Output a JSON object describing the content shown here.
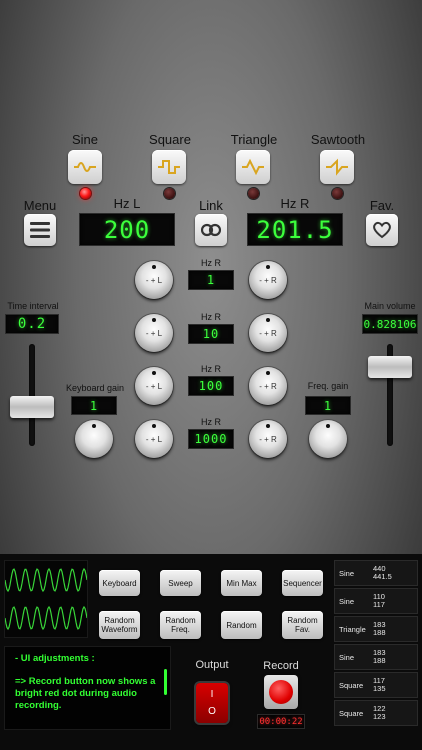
{
  "waveforms": [
    {
      "label": "Sine",
      "active": true
    },
    {
      "label": "Square",
      "active": false
    },
    {
      "label": "Triangle",
      "active": false
    },
    {
      "label": "Sawtooth",
      "active": false
    }
  ],
  "menu_label": "Menu",
  "link_label": "Link",
  "fav_label": "Fav.",
  "hz_l": {
    "label": "Hz L",
    "value": "200"
  },
  "hz_r": {
    "label": "Hz R",
    "value": "201.5"
  },
  "knob_minus_l": "- + L",
  "knob_minus_r": "- + R",
  "steps": [
    {
      "label": "Hz R",
      "value": "1"
    },
    {
      "label": "Hz R",
      "value": "10"
    },
    {
      "label": "Hz R",
      "value": "100"
    },
    {
      "label": "Hz R",
      "value": "1000"
    }
  ],
  "time_interval": {
    "label": "Time interval",
    "value": "0.2"
  },
  "main_volume": {
    "label": "Main volume",
    "value": "0.828106"
  },
  "keyboard_gain": {
    "label": "Keyboard gain",
    "value": "1"
  },
  "freq_gain": {
    "label": "Freq. gain",
    "value": "1"
  },
  "pads": [
    {
      "label": "Keyboard"
    },
    {
      "label": "Sweep"
    },
    {
      "label": "Min Max"
    },
    {
      "label": "Sequencer"
    },
    {
      "label": "Random Waveform"
    },
    {
      "label": "Random Freq."
    },
    {
      "label": "Random"
    },
    {
      "label": "Random Fav."
    }
  ],
  "log": {
    "title": "- UI adjustments :",
    "body": "=> Record button now shows a bright red dot during audio recording."
  },
  "output_label": "Output",
  "record_label": "Record",
  "record_time": "00:00:22",
  "power_on": "I",
  "power_off": "O",
  "presets": [
    {
      "name": "Sine",
      "l": "440",
      "r": "441.5"
    },
    {
      "name": "Sine",
      "l": "110",
      "r": "117"
    },
    {
      "name": "Triangle",
      "l": "183",
      "r": "188"
    },
    {
      "name": "Sine",
      "l": "183",
      "r": "188"
    },
    {
      "name": "Square",
      "l": "117",
      "r": "135"
    },
    {
      "name": "Square",
      "l": "122",
      "r": "123"
    }
  ],
  "colors": {
    "lcd_green": "#3cff3c",
    "led_red": "#ff1a1a",
    "wave_green": "#39d639",
    "log_green": "#33ff33"
  },
  "sliders": {
    "time_interval_level": 0.35,
    "main_volume_level": 0.85
  }
}
